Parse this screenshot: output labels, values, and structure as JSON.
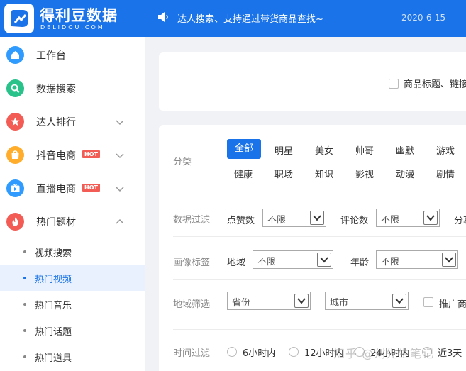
{
  "colors": {
    "brand": "#1a73e8",
    "hot": "#f25c54"
  },
  "header": {
    "brand_name": "得利豆数据",
    "brand_sub": "DELIDOU.COM",
    "announcement_icon": "speaker-icon",
    "announcement": "达人搜索、支持通过带货商品查找~",
    "date": "2020-6-15"
  },
  "sidebar": {
    "items": [
      {
        "label": "工作台",
        "icon": "home-icon",
        "color": "#2f9bff"
      },
      {
        "label": "数据搜索",
        "icon": "search-icon",
        "color": "#29c28b"
      },
      {
        "label": "达人排行",
        "icon": "star-icon",
        "color": "#f25c54"
      },
      {
        "label": "抖音电商",
        "icon": "bag-icon",
        "color": "#ffad2b",
        "badge": "HOT"
      },
      {
        "label": "直播电商",
        "icon": "tv-icon",
        "color": "#2f9bff",
        "badge": "HOT"
      },
      {
        "label": "热门题材",
        "icon": "fire-icon",
        "color": "#f25c54"
      }
    ],
    "sub_items": [
      "视频搜索",
      "热门视频",
      "热门音乐",
      "热门话题",
      "热门道具"
    ],
    "active_sub": "热门视频"
  },
  "search": {
    "checkbox_label": "商品标题、链接"
  },
  "filters": {
    "category": {
      "label": "分类",
      "tags": [
        "全部",
        "明星",
        "美女",
        "帅哥",
        "幽默",
        "游戏",
        "健康",
        "职场",
        "知识",
        "影视",
        "动漫",
        "剧情"
      ],
      "active": "全部"
    },
    "data_filter": {
      "label": "数据过滤",
      "likes_label": "点赞数",
      "likes_value": "不限",
      "comments_label": "评论数",
      "comments_value": "不限",
      "shares_label": "分享"
    },
    "portrait": {
      "label": "画像标签",
      "region_label": "地域",
      "region_value": "不限",
      "age_label": "年龄",
      "age_value": "不限"
    },
    "region": {
      "label": "地域筛选",
      "province": "省份",
      "city": "城市",
      "promo_label": "推广商"
    },
    "time": {
      "label": "时间过滤",
      "options": [
        "6小时内",
        "12小时内",
        "24小时内",
        "近3天"
      ]
    }
  },
  "watermark": "知乎 @刘先生笔记"
}
